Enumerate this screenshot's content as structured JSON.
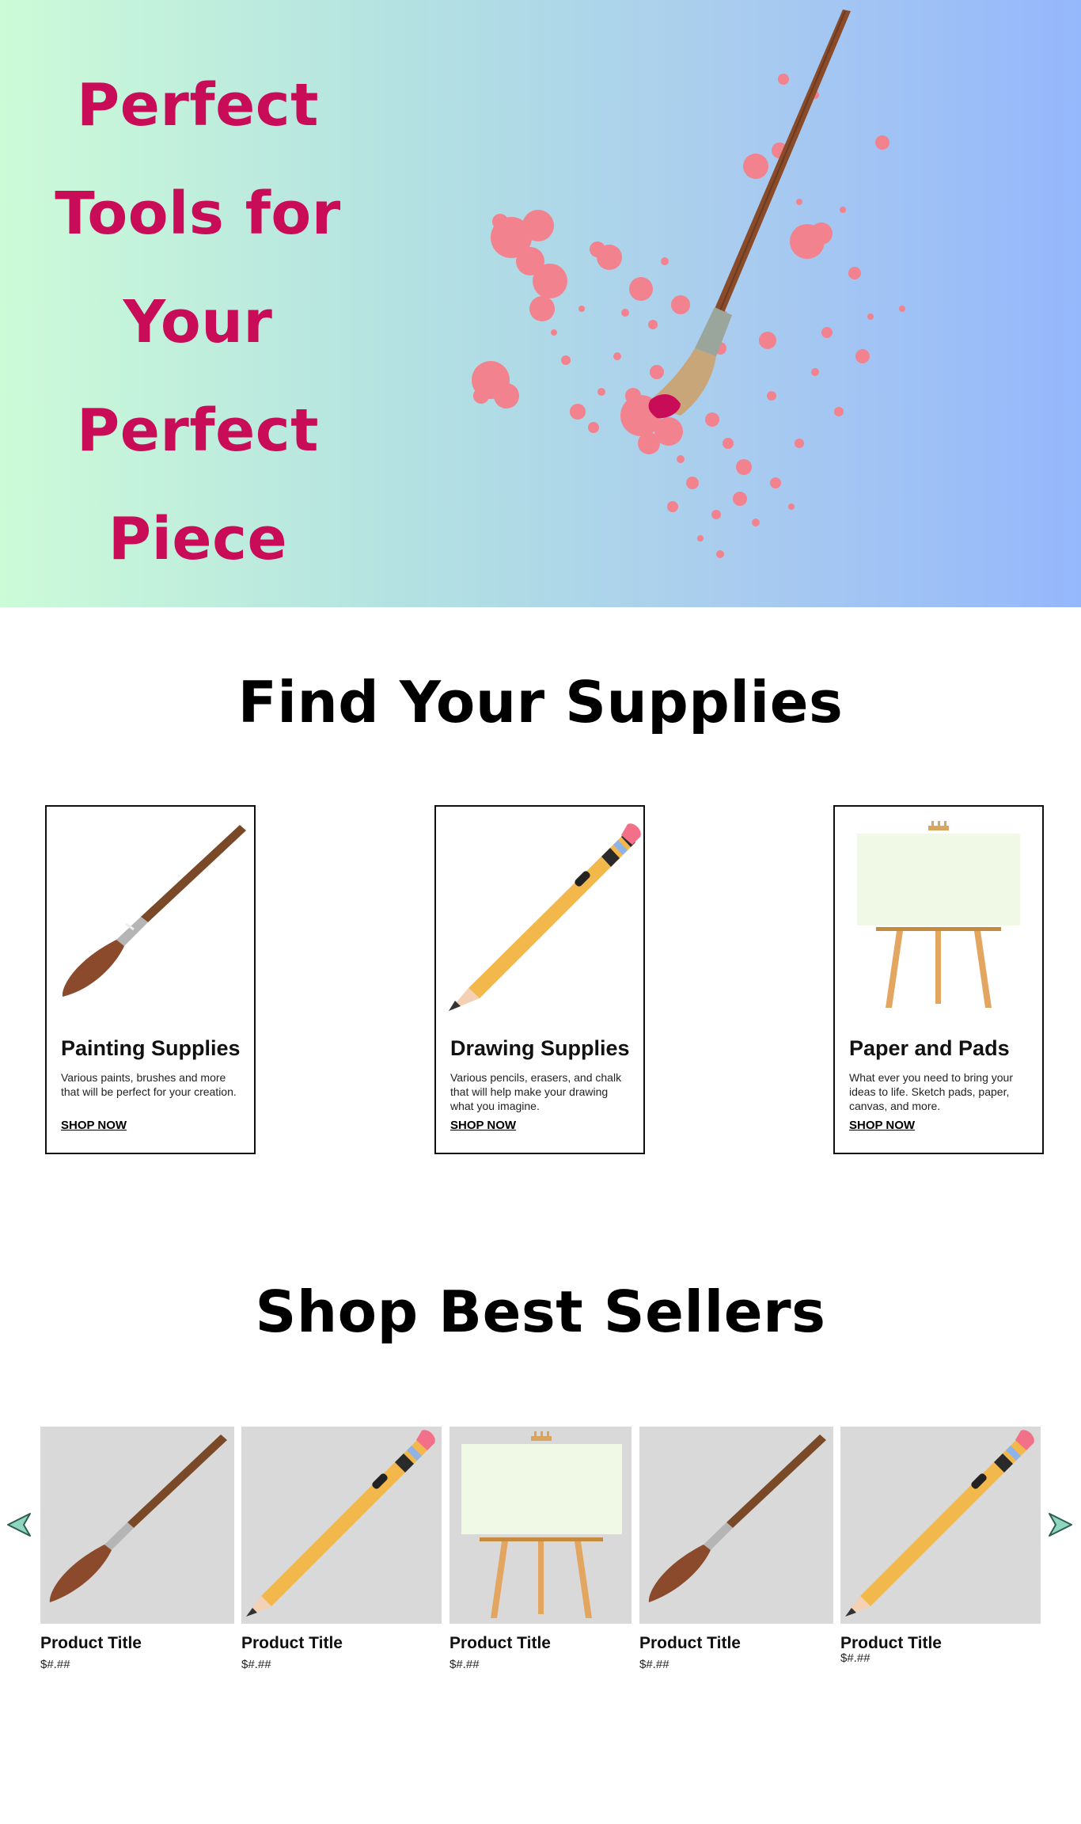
{
  "hero": {
    "title": "Perfect Tools for Your Perfect Piece"
  },
  "colors": {
    "hero_title": "#c90c58",
    "hero_gradient_start": "#ccfbd8",
    "hero_gradient_end": "#95b7fc",
    "paint_splatter": "#f2828e",
    "product_thumb_bg": "#d9d9d9"
  },
  "find_supplies": {
    "heading": "Find Your Supplies",
    "cards": [
      {
        "title": "Painting Supplies",
        "description": "Various paints, brushes and more that will be perfect for your creation.",
        "link": "SHOP NOW",
        "icon": "paintbrush-icon"
      },
      {
        "title": "Drawing Supplies",
        "description": "Various pencils, erasers, and chalk that will help make your drawing what you imagine.",
        "link": "SHOP NOW",
        "icon": "pencil-icon"
      },
      {
        "title": "Paper and Pads",
        "description": "What ever you need to bring your ideas to life. Sketch pads, paper, canvas, and more.",
        "link": "SHOP NOW",
        "icon": "easel-icon"
      }
    ]
  },
  "best_sellers": {
    "heading": "Shop Best Sellers",
    "prev_icon": "arrow-left-icon",
    "next_icon": "arrow-right-icon",
    "products": [
      {
        "title": "Product Title",
        "price": "$#.##",
        "icon": "paintbrush-icon"
      },
      {
        "title": "Product Title",
        "price": "$#.##",
        "icon": "pencil-icon"
      },
      {
        "title": "Product Title",
        "price": "$#.##",
        "icon": "easel-icon"
      },
      {
        "title": "Product Title",
        "price": "$#.##",
        "icon": "paintbrush-icon"
      },
      {
        "title": "Product Title",
        "price": "$#.##",
        "icon": "pencil-icon"
      }
    ]
  }
}
